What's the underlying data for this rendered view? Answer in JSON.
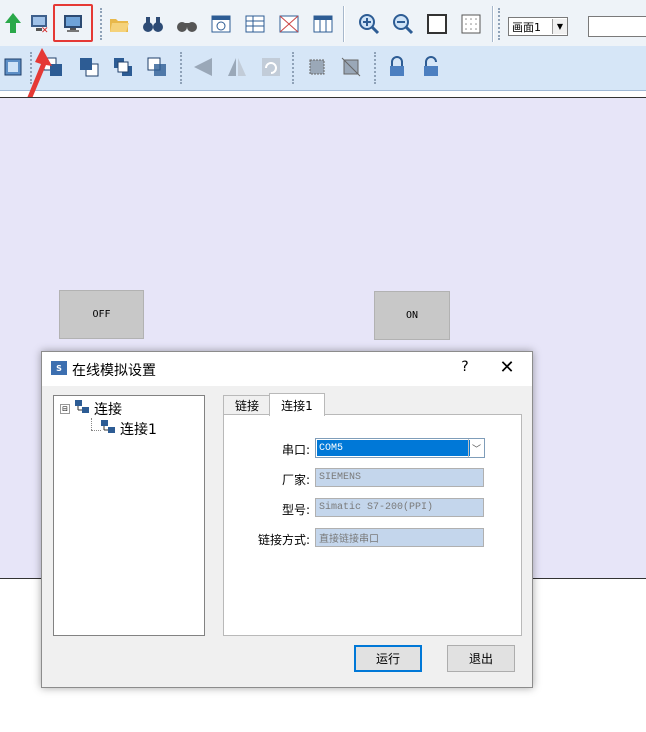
{
  "toolbar": {
    "combo_value": "画面1",
    "highlight_color": "#e53935",
    "row1_icons": [
      "arrow-up-icon",
      "stop-simulation-icon",
      "online-simulation-icon",
      "open-folder-icon",
      "binoculars-icon",
      "find-icon",
      "window-icon",
      "table-icon",
      "cross-table-icon",
      "list-icon",
      "zoom-in-icon",
      "zoom-out-icon",
      "fit-page-icon",
      "grid-icon"
    ],
    "row2_icons": [
      "select-all-icon",
      "bring-front-icon",
      "send-back-icon",
      "bring-forward-icon",
      "send-backward-icon",
      "flip-horizontal-icon",
      "flip-vertical-icon",
      "rotate-icon",
      "group-icon",
      "ungroup-icon",
      "lock-icon",
      "unlock-icon"
    ]
  },
  "canvas": {
    "background": "#e7e5f8",
    "off_label": "OFF",
    "on_label": "ON"
  },
  "dialog": {
    "icon_text": "S",
    "title": "在线模拟设置",
    "help_label": "?",
    "close_label": "✕",
    "tree": {
      "root": {
        "label": "连接",
        "toggle": "⊟"
      },
      "child": {
        "label": "连接1"
      }
    },
    "tabs": [
      {
        "label": "链接",
        "active": false
      },
      {
        "label": "连接1",
        "active": true
      }
    ],
    "form": {
      "port_label": "串口:",
      "port_value": "COM5",
      "vendor_label": "厂家:",
      "vendor_value": "SIEMENS",
      "model_label": "型号:",
      "model_value": "Simatic S7-200(PPI)",
      "link_label": "链接方式:",
      "link_value": "直接链接串口"
    },
    "buttons": {
      "run": "运行",
      "exit": "退出"
    }
  }
}
